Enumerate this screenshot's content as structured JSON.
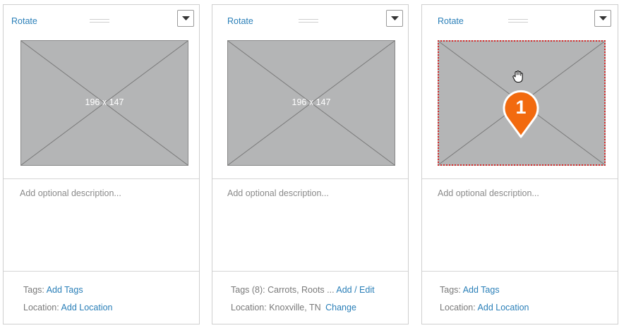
{
  "cards": [
    {
      "rotate_label": "Rotate",
      "placeholder_text": "196 x 147",
      "description_placeholder": "Add optional description...",
      "tags_label": "Tags:",
      "tags_link": "Add Tags",
      "location_label": "Location:",
      "location_link": "Add Location"
    },
    {
      "rotate_label": "Rotate",
      "placeholder_text": "196 x 147",
      "description_placeholder": "Add optional description...",
      "tags_label": "Tags (8): Carrots, Roots ...",
      "tags_link": "Add / Edit",
      "location_label": "Location: Knoxville, TN",
      "location_link": "Change"
    },
    {
      "rotate_label": "Rotate",
      "description_placeholder": "Add optional description...",
      "tags_label": "Tags:",
      "tags_link": "Add Tags",
      "location_label": "Location:",
      "location_link": "Add Location",
      "marker_number": "1"
    }
  ],
  "icons": {
    "menu": "chevron-down-icon",
    "drag": "drag-handle-icon",
    "cursor": "hand-grab-icon",
    "marker": "map-pin-marker-icon"
  },
  "colors": {
    "link": "#2a7fb8",
    "placeholder_fill": "#b4b5b6",
    "selection_border": "#d42b2b",
    "marker_fill": "#f26a0f"
  }
}
